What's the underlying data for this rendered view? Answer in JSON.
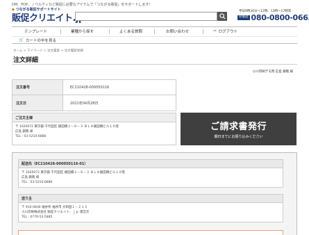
{
  "header": {
    "tagline": "DM、POP、ノベルティなど販促に必要なアイテムで「つながる販促」をサポートします！",
    "logo_sub": "つながる販促サポートサイト",
    "logo_text": "販促クリエイト",
    "logo_suffix": ".jp",
    "search_placeholder": "",
    "phone_hours": "平日9時30分〜12時、13時〜17時迄",
    "phone_badge": "お電話",
    "phone_number": "080-0800-0663"
  },
  "nav": {
    "row1": [
      "テンプレート",
      "業種から探す",
      "よくある質問",
      "お問い合わせ",
      "ログアウト"
    ],
    "row2": [
      "カートの中を見る"
    ]
  },
  "breadcrumb": "ホーム > マイページ > 注文履歴 > 注文履歴詳細",
  "page_title": "注文詳細",
  "store_name": "小川印刷デモ用 広島 鋼哉 様",
  "order": {
    "rows": [
      {
        "label": "注文番号",
        "value": "EC210428-000050116"
      },
      {
        "label": "注文日",
        "value": "2021年04月28日"
      }
    ]
  },
  "orderer": {
    "heading": "ご注文主様",
    "lines": [
      "〒 1020072 東京都 千代田区 飯田橋２－９－３ ＢＬＡ飯田橋ビル１０階",
      "広島 鋼哉 様",
      "TEL : 03-5210-6886"
    ]
  },
  "invoice": {
    "title": "ご請求書発行",
    "subtitle": "期日までにお振り込みください"
  },
  "shipments": [
    {
      "heading": "配送先（EC210428-000050116-01）",
      "lines": [
        "〒 1020072 東京都 千代田区 飯田橋２－９－３ ＢＬＡ飯田橋ビル１０階",
        "広島 鋼哉 様",
        "TEL : 03-5210-6886"
      ]
    },
    {
      "heading": "送り主",
      "lines": [
        "〒 910-0836 福井県 福井市 大和田１－２１３",
        "小川印刷株式会社 販促クリエイト．ｊｐ 運営元",
        "TEL : 0776-53-5885"
      ]
    }
  ],
  "colors": {
    "brand": "#1f3b7a",
    "invoice_bg": "#3f3f3f",
    "accent_border": "#f0a070"
  }
}
